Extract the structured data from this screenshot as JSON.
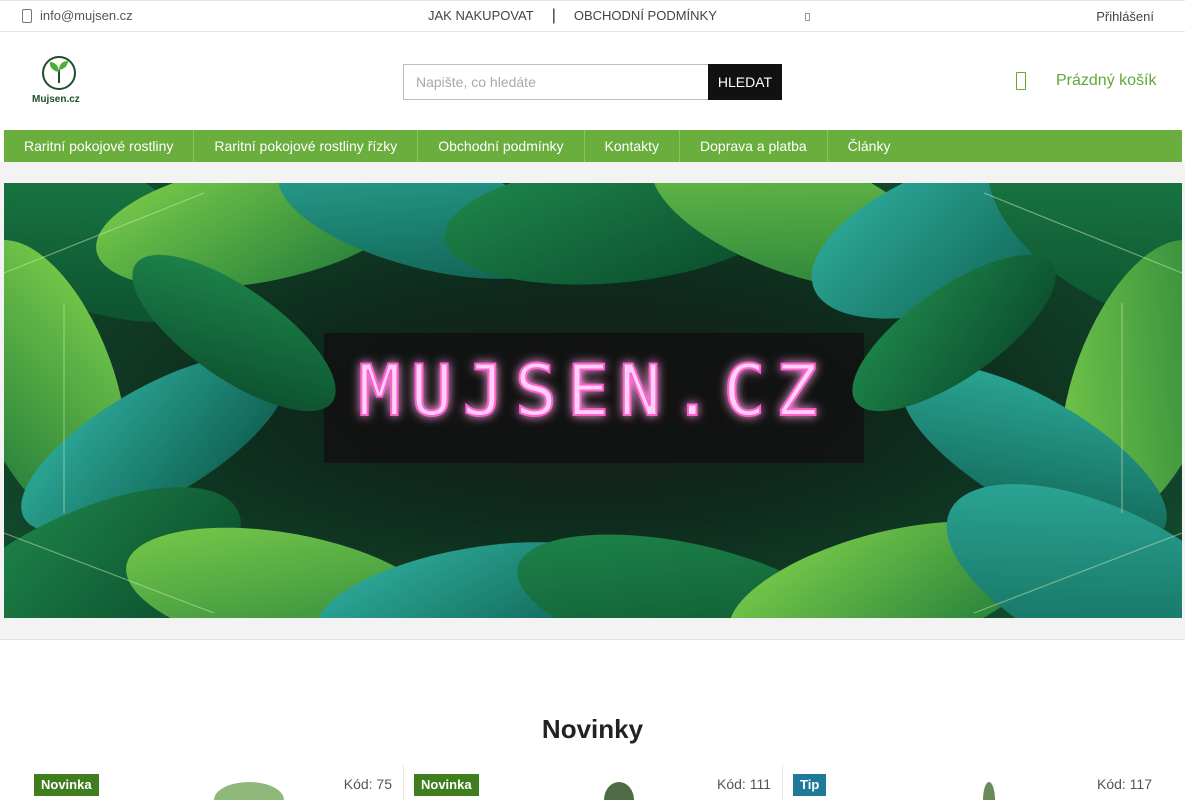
{
  "topbar": {
    "email": "info@mujsen.cz",
    "links": [
      "JAK NAKUPOVAT",
      "OBCHODNÍ PODMÍNKY"
    ],
    "separator": "|",
    "login": "Přihlášení"
  },
  "header": {
    "logo_text": "Mujsen.cz",
    "search": {
      "placeholder": "Napište, co hledáte",
      "button": "HLEDAT"
    },
    "cart_label": "Prázdný košík"
  },
  "nav": {
    "items": [
      "Raritní pokojové rostliny",
      "Raritní pokojové rostliny řízky",
      "Obchodní podmínky",
      "Kontakty",
      "Doprava a platba",
      "Články"
    ]
  },
  "banner": {
    "text": "MUJSEN.CZ"
  },
  "section": {
    "title": "Novinky"
  },
  "products": [
    {
      "badge": "Novinka",
      "code": "Kód: 75"
    },
    {
      "badge": "Novinka",
      "code": "Kód: 111"
    },
    {
      "badge": "Tip",
      "code": "Kód: 117"
    }
  ],
  "colors": {
    "accent_green": "#6aae3d",
    "badge_new": "#3f7d1f",
    "badge_tip": "#1f7a9a",
    "neon_pink": "#ff5fd2"
  }
}
